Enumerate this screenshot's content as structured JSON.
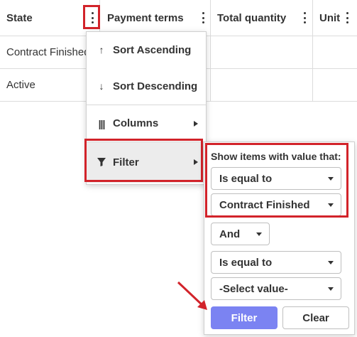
{
  "colors": {
    "highlight": "#d2232a",
    "primary_button": "#7b83f2",
    "arrow": "#d2232a"
  },
  "grid": {
    "columns": [
      {
        "label": "State",
        "icon": "kebab-icon"
      },
      {
        "label": "Payment terms",
        "icon": "kebab-icon"
      },
      {
        "label": "Total quantity",
        "icon": "kebab-icon"
      },
      {
        "label": "Unit",
        "icon": "kebab-icon"
      }
    ],
    "rows": [
      {
        "state": "Contract Finished"
      },
      {
        "state": "Active"
      }
    ]
  },
  "column_menu": {
    "items": [
      {
        "label": "Sort Ascending",
        "icon": "arrow-up-icon"
      },
      {
        "label": "Sort Descending",
        "icon": "arrow-down-icon"
      },
      {
        "label": "Columns",
        "icon": "columns-icon",
        "has_submenu": true
      },
      {
        "label": "Filter",
        "icon": "filter-icon",
        "has_submenu": true
      }
    ]
  },
  "filter_panel": {
    "title": "Show items with value that:",
    "operator1": "Is equal to",
    "value1": "Contract Finished",
    "logic": "And",
    "operator2": "Is equal to",
    "value2": "-Select value-",
    "filter_button": "Filter",
    "clear_button": "Clear"
  }
}
